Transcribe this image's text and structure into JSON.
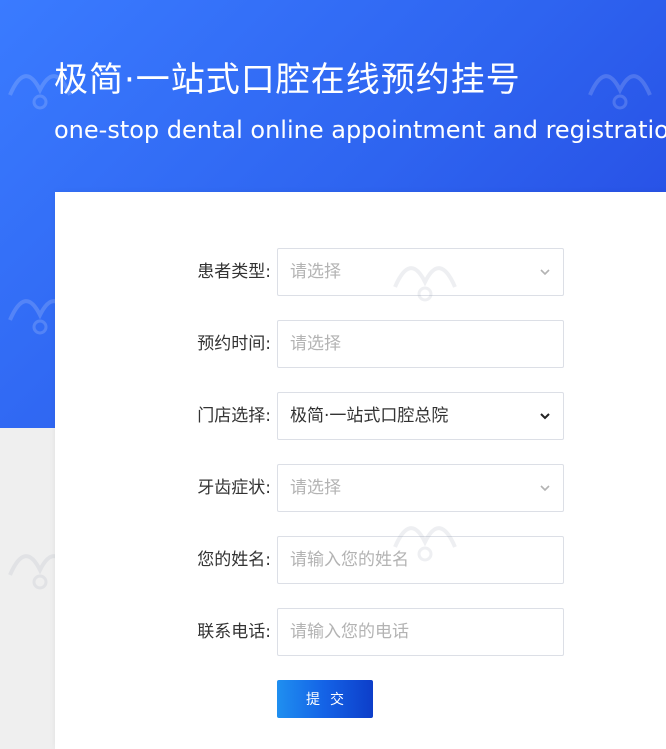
{
  "header": {
    "title": "极简·一站式口腔在线预约挂号",
    "subtitle": "one-stop dental online appointment and registration"
  },
  "form": {
    "fields": [
      {
        "label": "患者类型:",
        "text": "请选择",
        "kind": "select",
        "filled": false
      },
      {
        "label": "预约时间:",
        "text": "请选择",
        "kind": "input",
        "filled": false
      },
      {
        "label": "门店选择:",
        "text": "极简·一站式口腔总院",
        "kind": "select",
        "filled": true
      },
      {
        "label": "牙齿症状:",
        "text": "请选择",
        "kind": "select",
        "filled": false
      },
      {
        "label": "您的姓名:",
        "text": "请输入您的姓名",
        "kind": "input",
        "filled": false
      },
      {
        "label": "联系电话:",
        "text": "请输入您的电话",
        "kind": "input",
        "filled": false
      }
    ],
    "submit_label": "提交"
  },
  "icons": {
    "select_arrow": "chevron-down-icon",
    "watermark": "logo-watermark-icon"
  },
  "colors": {
    "accent": "#2e64f0",
    "button_start": "#1f8ff0",
    "button_end": "#0d3ec9"
  }
}
